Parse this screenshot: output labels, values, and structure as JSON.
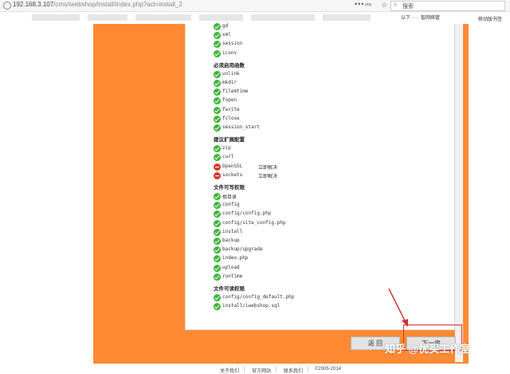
{
  "browser": {
    "url_host": "192.168.3.107",
    "url_path": "/cms/iwebshop/install/index.php?act=install_2",
    "php_tag": "php",
    "search_placeholder": "搜索",
    "bookmark_text": "以下 ·· ·· 智网络管",
    "bookmark_text2": "移动版书签"
  },
  "sections": [
    {
      "id": "top",
      "title": "",
      "items": [
        {
          "name": "gd",
          "status": "ok"
        },
        {
          "name": "xml",
          "status": "ok"
        },
        {
          "name": "session",
          "status": "ok"
        },
        {
          "name": "iconv",
          "status": "ok"
        }
      ]
    },
    {
      "id": "functions",
      "title": "必须启用函数",
      "items": [
        {
          "name": "unlink",
          "status": "ok"
        },
        {
          "name": "mkdir",
          "status": "ok"
        },
        {
          "name": "filemtime",
          "status": "ok"
        },
        {
          "name": "fopen",
          "status": "ok"
        },
        {
          "name": "fwrite",
          "status": "ok"
        },
        {
          "name": "fclose",
          "status": "ok"
        },
        {
          "name": "session_start",
          "status": "ok"
        }
      ]
    },
    {
      "id": "extensions",
      "title": "建议扩展配置",
      "items": [
        {
          "name": "zip",
          "status": "ok"
        },
        {
          "name": "curl",
          "status": "ok"
        },
        {
          "name": "OpenSSL",
          "status": "error",
          "fix": "立即解决"
        },
        {
          "name": "sockets",
          "status": "error",
          "fix": "立即解决"
        }
      ]
    },
    {
      "id": "writable",
      "title": "文件可写权限",
      "items": [
        {
          "name": "根目录",
          "status": "ok"
        },
        {
          "name": "config",
          "status": "ok"
        },
        {
          "name": "config/config.php",
          "status": "ok"
        },
        {
          "name": "config/site_config.php",
          "status": "ok"
        },
        {
          "name": "install",
          "status": "ok"
        },
        {
          "name": "backup",
          "status": "ok"
        },
        {
          "name": "backup/upgrade",
          "status": "ok"
        },
        {
          "name": "index.php",
          "status": "ok"
        },
        {
          "name": "upload",
          "status": "ok"
        },
        {
          "name": "runtime",
          "status": "ok"
        }
      ]
    },
    {
      "id": "readable",
      "title": "文件可读权限",
      "items": [
        {
          "name": "config/config_default.php",
          "status": "ok"
        },
        {
          "name": "install/iwebshop.sql",
          "status": "ok"
        }
      ]
    }
  ],
  "buttons": {
    "back": "返 回",
    "next": "下一步"
  },
  "footer": {
    "links": [
      "关于我们",
      "官方网站",
      "联系我们",
      "©2005-2014"
    ]
  },
  "watermark": "知乎 @优买工作室",
  "colors": {
    "orange": "#ff8a33",
    "ok": "#3db53a",
    "error": "#d63a2c",
    "highlight": "#d23030"
  }
}
